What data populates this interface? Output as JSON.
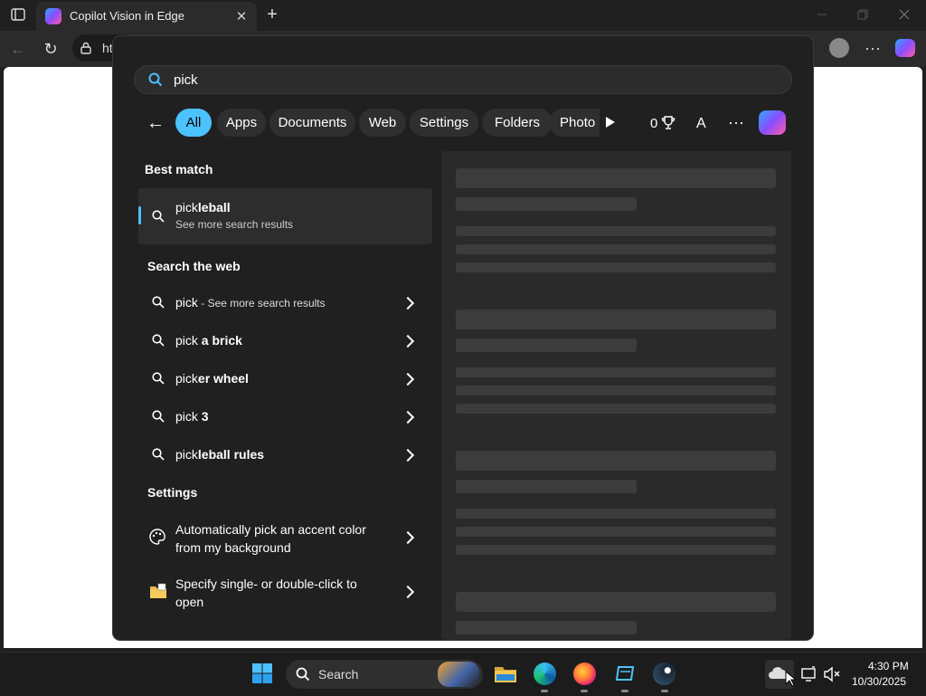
{
  "browser": {
    "tab_title": "Copilot Vision in Edge",
    "address_partial": "ht"
  },
  "search": {
    "query": "pick",
    "filters": [
      "All",
      "Apps",
      "Documents",
      "Web",
      "Settings",
      "Folders",
      "Photo"
    ],
    "points": "0",
    "account_initial": "A"
  },
  "best_match": {
    "header": "Best match",
    "title_match": "pick",
    "title_rest": "leball",
    "subtitle": "See more search results"
  },
  "web": {
    "header": "Search the web",
    "items": [
      {
        "prefix": "pick",
        "rest": "",
        "suffix": " - See more search results"
      },
      {
        "prefix": "pick",
        "rest": " a brick",
        "suffix": ""
      },
      {
        "prefix": "pick",
        "rest": "er wheel",
        "suffix": ""
      },
      {
        "prefix": "pick",
        "rest": " 3",
        "suffix": ""
      },
      {
        "prefix": "pick",
        "rest": "leball rules",
        "suffix": ""
      }
    ]
  },
  "settings": {
    "header": "Settings",
    "items": [
      {
        "line1": "Automatically pick an accent color",
        "line2": "from my background"
      },
      {
        "line1": "Specify single- or double-click to",
        "line2": "open"
      }
    ]
  },
  "taskbar": {
    "search_label": "Search",
    "time": "4:30 PM",
    "date": "10/30/2025"
  },
  "colors": {
    "accent": "#4cc2ff",
    "panel_bg": "#202020",
    "skeleton": "#3c3c3c"
  }
}
